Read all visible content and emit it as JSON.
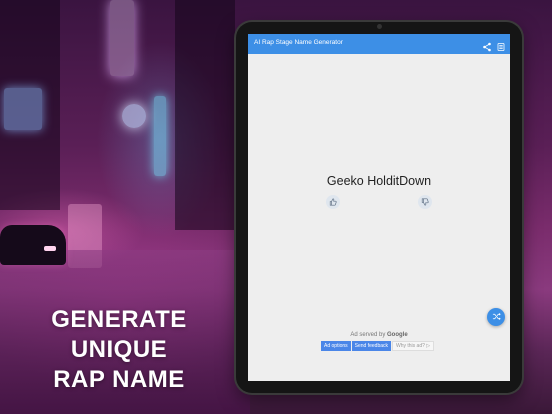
{
  "marketing": {
    "headline_line1": "GENERATE UNIQUE",
    "headline_line2": "RAP NAME"
  },
  "app": {
    "title": "AI Rap Stage Name Generator",
    "accent_color": "#3d8fe6",
    "toolbar_icons": [
      "share-icon",
      "menu-icon"
    ]
  },
  "main": {
    "generated_name": "Geeko HolditDown",
    "like_icon": "thumbs-up-icon",
    "dislike_icon": "thumbs-down-icon",
    "fab_icon": "shuffle-icon"
  },
  "ad": {
    "served_by_prefix": "Ad served by",
    "served_by_brand": "Google",
    "ad_options_label": "Ad options",
    "send_feedback_label": "Send feedback",
    "why_this_ad_label": "Why this ad? ▷"
  }
}
